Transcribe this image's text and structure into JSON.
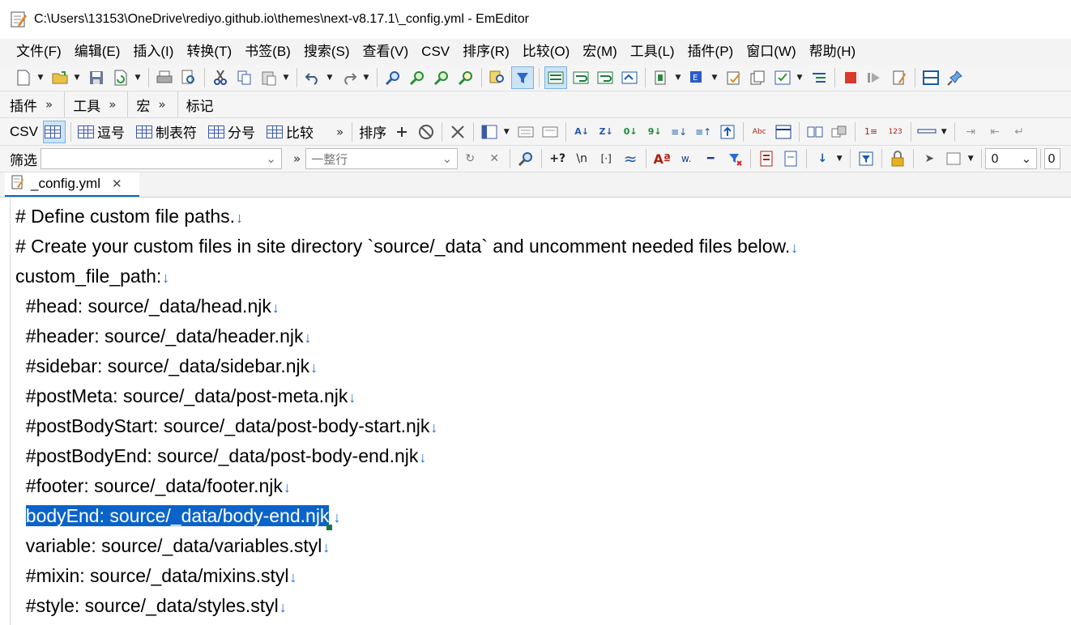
{
  "window": {
    "title": "C:\\Users\\13153\\OneDrive\\rediyo.github.io\\themes\\next-v8.17.1\\_config.yml - EmEditor"
  },
  "menu": [
    "文件(F)",
    "编辑(E)",
    "插入(I)",
    "转换(T)",
    "书签(B)",
    "搜索(S)",
    "查看(V)",
    "CSV",
    "排序(R)",
    "比较(O)",
    "宏(M)",
    "工具(L)",
    "插件(P)",
    "窗口(W)",
    "帮助(H)"
  ],
  "toolbar2": {
    "plugins": "插件",
    "tools": "工具",
    "macros": "宏",
    "markers": "标记",
    "chevron": "»"
  },
  "toolbar3": {
    "csv": "CSV",
    "comma": "逗号",
    "tab": "制表符",
    "semicolon": "分号",
    "compare": "比较",
    "sort": "排序"
  },
  "toolbar4": {
    "filter": "筛选",
    "mode": "一整行",
    "regex_plus": "+?",
    "newline": "\\n",
    "brackets": "[·]",
    "zero": "0"
  },
  "tab": {
    "name": "_config.yml",
    "close": "✕"
  },
  "editor": {
    "lines": [
      "# Define custom file paths.",
      "# Create your custom files in site directory `source/_data` and uncomment needed files below.",
      "custom_file_path:",
      "  #head: source/_data/head.njk",
      "  #header: source/_data/header.njk",
      "  #sidebar: source/_data/sidebar.njk",
      "  #postMeta: source/_data/post-meta.njk",
      "  #postBodyStart: source/_data/post-body-start.njk",
      "  #postBodyEnd: source/_data/post-body-end.njk",
      "  #footer: source/_data/footer.njk",
      "bodyEnd: source/_data/body-end.njk",
      "  variable: source/_data/variables.styl",
      "  #mixin: source/_data/mixins.styl",
      "  #style: source/_data/styles.styl"
    ],
    "newline_mark": "↓"
  },
  "colors": {
    "selection": "#0a63c9",
    "newline": "#1b6fd4",
    "tab_accent": "#0a63c9"
  }
}
